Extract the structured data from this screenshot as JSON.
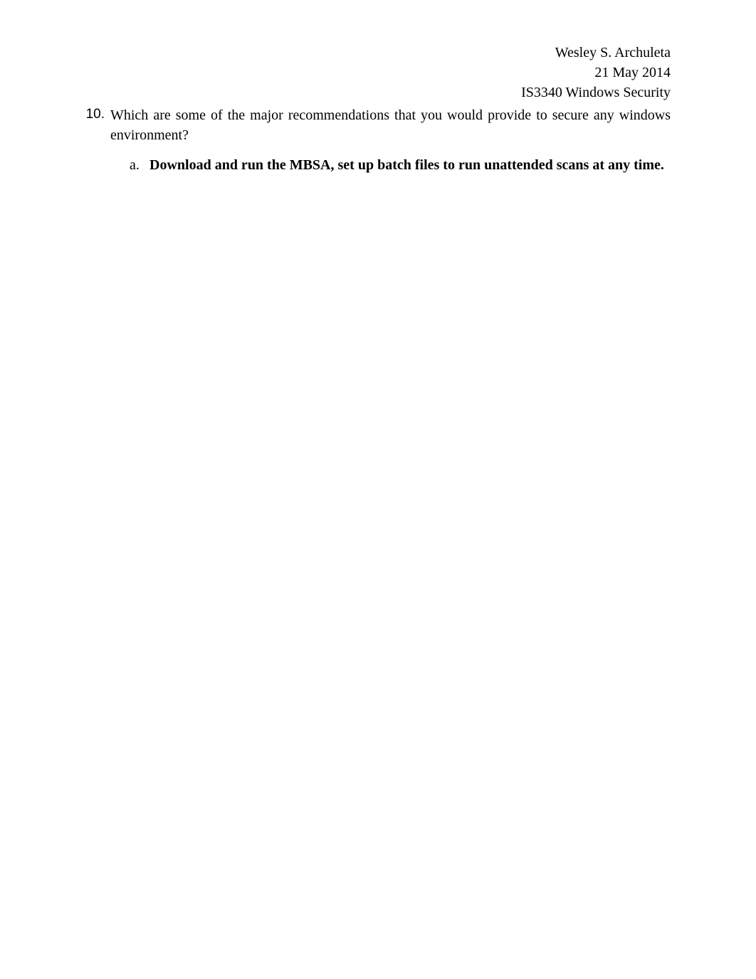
{
  "header": {
    "author": "Wesley S. Archuleta",
    "date": "21 May 2014",
    "course": "IS3340 Windows Security"
  },
  "content": {
    "question": {
      "number": "10.",
      "text": "Which are some of the major recommendations that you would provide to secure any windows environment?"
    },
    "answers": [
      {
        "letter": "a.",
        "text": "Download and run the MBSA, set up batch files to run unattended scans at any time."
      }
    ]
  }
}
